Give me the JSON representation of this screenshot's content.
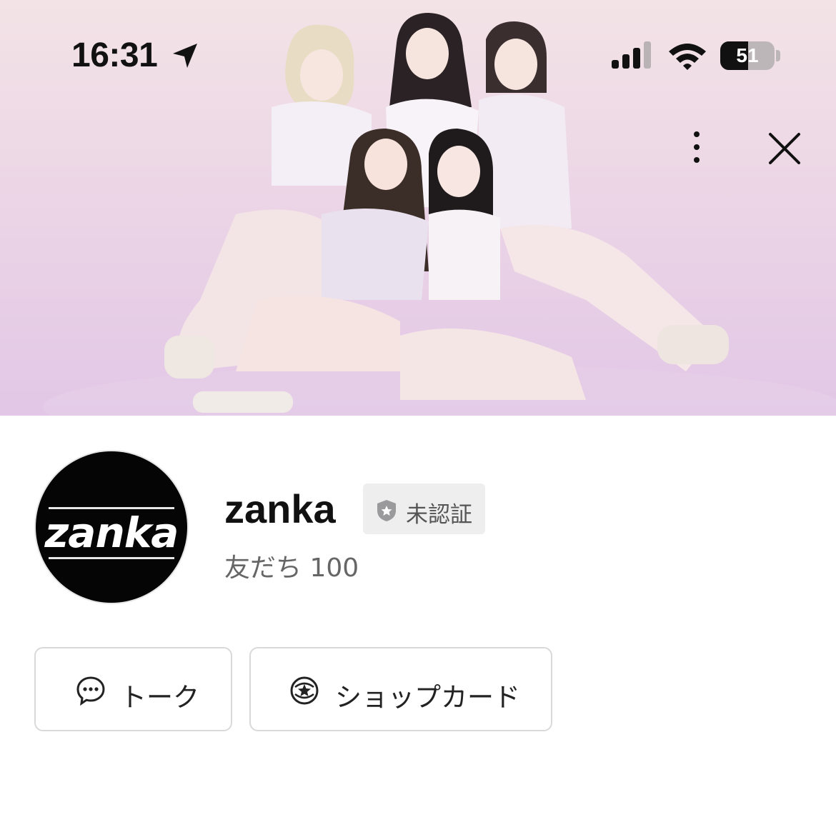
{
  "status_bar": {
    "time": "16:31",
    "battery_level": "51",
    "battery_fraction": 0.51,
    "icons": [
      "location-arrow-icon",
      "cellular-signal-icon",
      "wifi-icon",
      "battery-icon"
    ]
  },
  "header": {
    "more_icon": "vertical-ellipsis-icon",
    "close_icon": "close-x-icon"
  },
  "profile": {
    "avatar_text": "zanka",
    "name": "zanka",
    "badge_label": "未認証",
    "badge_icon": "shield-star-icon",
    "friends_label": "友だち 100"
  },
  "actions": {
    "talk_label": "トーク",
    "talk_icon": "chat-bubble-icon",
    "shop_card_label": "ショップカード",
    "shop_card_icon": "shop-card-icon"
  },
  "colors": {
    "cover_top": "#f3e3e6",
    "cover_bottom": "#e2c7e6",
    "badge_bg": "#eeeeef",
    "button_border": "#d9d9d9"
  }
}
